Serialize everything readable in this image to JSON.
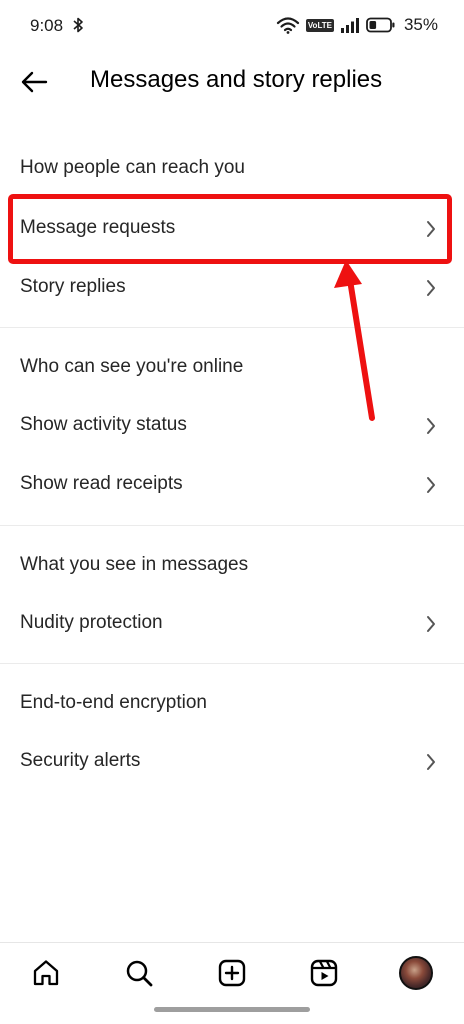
{
  "status_bar": {
    "time": "9:08",
    "volte": "VoLTE",
    "battery_percent": "35%",
    "battery_level": 0.35
  },
  "header": {
    "title": "Messages and story replies"
  },
  "sections": [
    {
      "heading": "How people can reach you",
      "items": [
        {
          "label": "Message requests"
        },
        {
          "label": "Story replies"
        }
      ]
    },
    {
      "heading": "Who can see you're online",
      "items": [
        {
          "label": "Show activity status"
        },
        {
          "label": "Show read receipts"
        }
      ]
    },
    {
      "heading": "What you see in messages",
      "items": [
        {
          "label": "Nudity protection"
        }
      ]
    },
    {
      "heading": "End-to-end encryption",
      "items": [
        {
          "label": "Security alerts"
        }
      ]
    }
  ],
  "annotation": {
    "color": "#ee1111"
  },
  "bottom_nav": {
    "items": [
      "home-icon",
      "search-icon",
      "create-icon",
      "reels-icon",
      "profile-avatar"
    ]
  }
}
